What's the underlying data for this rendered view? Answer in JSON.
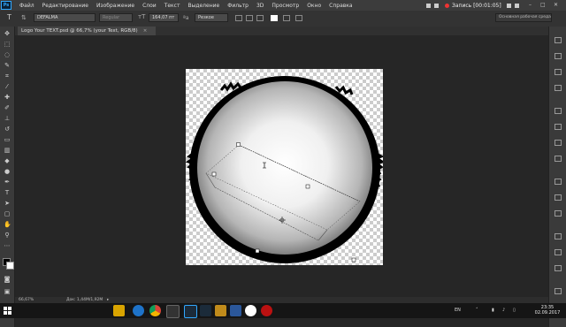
{
  "app": {
    "logo": "Ps"
  },
  "menu": [
    "Файл",
    "Редактирование",
    "Изображение",
    "Слои",
    "Текст",
    "Выделение",
    "Фильтр",
    "3D",
    "Просмотр",
    "Окно",
    "Справка"
  ],
  "recording": {
    "label": "Запись [00:01:05]"
  },
  "options": {
    "font_family": "DEFALMA",
    "font_style": "Regular",
    "font_size": "164,07 пт",
    "antialias": "Резкое",
    "workspace": "Основная рабочая среда"
  },
  "document": {
    "tab_title": "Logo Your TEXT.psd @ 66,7% (your Text, RGB/8)",
    "close": "×"
  },
  "status": {
    "zoom": "66,67%",
    "doc_size": "Док: 1,44М/1,92М"
  },
  "taskbar": {
    "lang": "EN",
    "time": "23:35",
    "date": "02.09.2017",
    "apps": [
      "explorer-icon",
      "ie-icon",
      "chrome-icon",
      "vegas-icon",
      "obs-icon",
      "photoshop-icon",
      "folder-icon",
      "word-icon",
      "yandex-icon",
      "recorder-icon"
    ]
  },
  "colors": {
    "ps_blue": "#31a8ff",
    "menubar": "#3c3c3c",
    "canvas_bg": "#262626"
  }
}
